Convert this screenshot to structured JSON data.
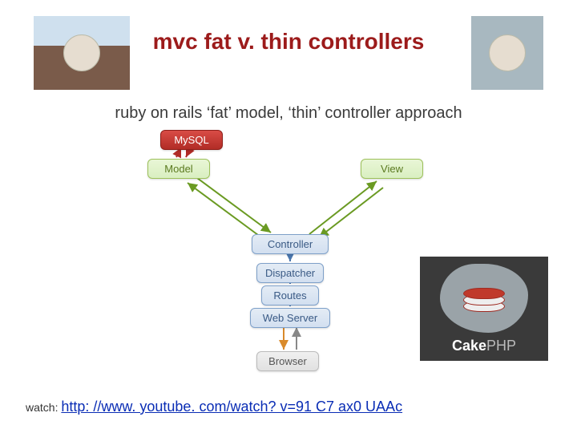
{
  "title": "mvc fat v. thin controllers",
  "subtitle": "ruby on rails ‘fat’ model, ‘thin’ controller approach",
  "diagram": {
    "nodes": {
      "mysql": "MySQL",
      "model": "Model",
      "view": "View",
      "controller": "Controller",
      "dispatcher": "Dispatcher",
      "routes": "Routes",
      "webserver": "Web Server",
      "browser": "Browser"
    }
  },
  "logo": {
    "name": "CakePHP",
    "prefix": "Cake",
    "suffix": "PHP"
  },
  "footer": {
    "prefix": "watch: ",
    "link_text": "http: //www. youtube. com/watch? v=91 C7 ax0 UAAc",
    "link_href": "http://www.youtube.com/watch?v=91C7ax0UAAc"
  },
  "images": {
    "left_alt": "fat-controller-character",
    "right_alt": "thin-controller-character"
  }
}
